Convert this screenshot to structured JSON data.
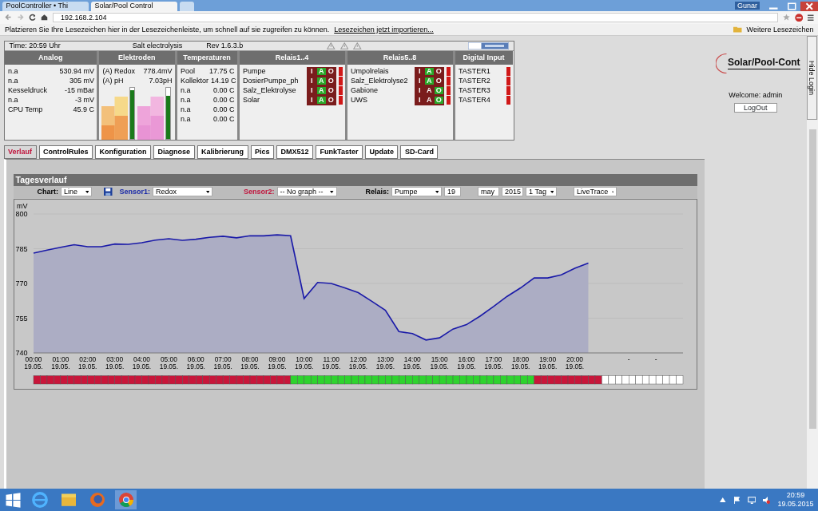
{
  "browser": {
    "tabs": [
      {
        "label": "PoolController • Thi",
        "selected": false
      },
      {
        "label": "Solar/Pool Control",
        "selected": true
      }
    ],
    "user": "Gunar",
    "address": "192.168.2.104",
    "bookmarks_hint": "Platzieren Sie Ihre Lesezeichen hier in der Lesezeichenleiste, um schnell auf sie zugreifen zu können.",
    "bookmarks_link": "Lesezeichen jetzt importieren...",
    "bookmarks_more": "Weitere Lesezeichen"
  },
  "status": {
    "time": "Time: 20:59 Uhr",
    "mode": "Salt electrolysis",
    "revision": "Rev 1.6.3.b"
  },
  "analog": {
    "title": "Analog",
    "rows": [
      {
        "label": "n.a",
        "value": "530.94 mV"
      },
      {
        "label": "n.a",
        "value": "305 mV"
      },
      {
        "label": "Kesseldruck",
        "value": "-15 mBar"
      },
      {
        "label": "n.a",
        "value": "-3 mV"
      },
      {
        "label": "CPU Temp",
        "value": "45.9 C"
      }
    ]
  },
  "electrodes": {
    "title": "Elektroden",
    "rows": [
      {
        "label": "(A) Redox",
        "value": "778.4mV",
        "level": 0.95
      },
      {
        "label": "(A) pH",
        "value": "7.03pH",
        "level": 0.85
      }
    ]
  },
  "temperatures": {
    "title": "Temperaturen",
    "rows": [
      {
        "label": "Pool",
        "value": "17.75 C"
      },
      {
        "label": "Kollektor",
        "value": "14.19 C"
      },
      {
        "label": "n.a",
        "value": "0.00 C"
      },
      {
        "label": "n.a",
        "value": "0.00 C"
      },
      {
        "label": "n.a",
        "value": "0.00 C"
      },
      {
        "label": "n.a",
        "value": "0.00 C"
      }
    ]
  },
  "relays": [
    {
      "title": "Relais1..4",
      "items": [
        {
          "name": "Pumpe",
          "modes": [
            {
              "label": "I",
              "selected": false
            },
            {
              "label": "A",
              "selected": true
            },
            {
              "label": "O",
              "selected": false
            }
          ],
          "on": false
        },
        {
          "name": "DosierPumpe_ph",
          "modes": [
            {
              "label": "I",
              "selected": false
            },
            {
              "label": "A",
              "selected": true
            },
            {
              "label": "O",
              "selected": false
            }
          ],
          "on": false
        },
        {
          "name": "Salz_Elektrolyse",
          "modes": [
            {
              "label": "I",
              "selected": false
            },
            {
              "label": "A",
              "selected": true
            },
            {
              "label": "O",
              "selected": false
            }
          ],
          "on": false
        },
        {
          "name": "Solar",
          "modes": [
            {
              "label": "I",
              "selected": false
            },
            {
              "label": "A",
              "selected": true
            },
            {
              "label": "O",
              "selected": false
            }
          ],
          "on": false
        }
      ]
    },
    {
      "title": "Relais5..8",
      "items": [
        {
          "name": "Umpolrelais",
          "modes": [
            {
              "label": "I",
              "selected": false
            },
            {
              "label": "A",
              "selected": true
            },
            {
              "label": "O",
              "selected": false
            }
          ],
          "on": false
        },
        {
          "name": "Salz_Elektrolyse2",
          "modes": [
            {
              "label": "I",
              "selected": false
            },
            {
              "label": "A",
              "selected": true
            },
            {
              "label": "O",
              "selected": false
            }
          ],
          "on": false
        },
        {
          "name": "Gabione",
          "modes": [
            {
              "label": "I",
              "selected": false
            },
            {
              "label": "A",
              "selected": false
            },
            {
              "label": "O",
              "selected": true
            }
          ],
          "on": false
        },
        {
          "name": "UWS",
          "modes": [
            {
              "label": "I",
              "selected": false
            },
            {
              "label": "A",
              "selected": false
            },
            {
              "label": "O",
              "selected": true
            }
          ],
          "on": false
        }
      ]
    }
  ],
  "digital_input": {
    "title": "Digital Input",
    "items": [
      {
        "name": "TASTER1",
        "on": false
      },
      {
        "name": "TASTER2",
        "on": false
      },
      {
        "name": "TASTER3",
        "on": false
      },
      {
        "name": "TASTER4",
        "on": false
      }
    ]
  },
  "tabs": [
    {
      "label": "Verlauf",
      "selected": true
    },
    {
      "label": "ControlRules",
      "selected": false
    },
    {
      "label": "Konfiguration",
      "selected": false
    },
    {
      "label": "Diagnose",
      "selected": false
    },
    {
      "label": "Kalibrierung",
      "selected": false
    },
    {
      "label": "Pics",
      "selected": false
    },
    {
      "label": "DMX512",
      "selected": false
    },
    {
      "label": "FunkTaster",
      "selected": false
    },
    {
      "label": "Update",
      "selected": false
    },
    {
      "label": "SD-Card",
      "selected": false
    }
  ],
  "panel": {
    "title": "Tagesverlauf",
    "controls": [
      {
        "kind": "label",
        "text": "Chart:"
      },
      {
        "kind": "select",
        "value": "Line"
      },
      {
        "kind": "save"
      },
      {
        "kind": "sensor1",
        "text": "Sensor1:"
      },
      {
        "kind": "select",
        "value": "Redox"
      },
      {
        "kind": "sensor2",
        "text": "Sensor2:"
      },
      {
        "kind": "select",
        "value": "-- No graph --"
      },
      {
        "kind": "label",
        "text": "Relais:"
      },
      {
        "kind": "select",
        "value": "Pumpe"
      },
      {
        "kind": "select",
        "value": "19"
      },
      {
        "kind": "select",
        "value": "may"
      },
      {
        "kind": "select",
        "value": "2015"
      },
      {
        "kind": "select",
        "value": "1 Tag"
      },
      {
        "kind": "select",
        "value": "LiveTrace"
      }
    ],
    "chart_data": {
      "type": "area",
      "ylabel": "mV",
      "categories": [
        "00:00 19.05.",
        null,
        "01:00 19.05.",
        null,
        "02:00 19.05.",
        null,
        "03:00 19.05.",
        null,
        "04:00 19.05.",
        null,
        "05:00 19.05.",
        null,
        "06:00 19.05.",
        null,
        "07:00 19.05.",
        null,
        "08:00 19.05.",
        null,
        "09:00 19.05.",
        null,
        "10:00 19.05.",
        null,
        "11:00 19.05.",
        null,
        "12:00 19.05.",
        null,
        "13:00 19.05.",
        null,
        "14:00 19.05.",
        null,
        "15:00 19.05.",
        null,
        "16:00 19.05.",
        null,
        "17:00 19.05.",
        null,
        "18:00 19.05.",
        null,
        "19:00 19.05.",
        null,
        "20:00 19.05.",
        null,
        null,
        null,
        "-",
        null,
        "-",
        null
      ],
      "series": [
        {
          "color": "#1a1aa8",
          "values": [
            783.1,
            784.4,
            785.6,
            786.7,
            785.9,
            785.9,
            787,
            786.9,
            787.6,
            788.7,
            789.3,
            788.6,
            789.1,
            789.9,
            790.4,
            789.7,
            790.6,
            790.6,
            791,
            790.6,
            763.5,
            770.4,
            770,
            768.1,
            766,
            762.3,
            758.4,
            749.2,
            748.4,
            745.6,
            746.5,
            750.3,
            752.2,
            755.9,
            760,
            764.4,
            768.1,
            772.4,
            772.4,
            773.7,
            776.5,
            778.8,
            null,
            null,
            null,
            null,
            null,
            null
          ]
        }
      ],
      "ylim": [
        740,
        800
      ],
      "yticks": [
        740,
        755,
        770,
        785,
        800
      ],
      "grid": true
    },
    "relay_timeline": [
      {
        "kind": "off"
      },
      {
        "kind": "off"
      },
      {
        "kind": "off"
      },
      {
        "kind": "off"
      },
      {
        "kind": "off"
      },
      {
        "kind": "off"
      },
      {
        "kind": "off"
      },
      {
        "kind": "off"
      },
      {
        "kind": "off"
      },
      {
        "kind": "off"
      },
      {
        "kind": "off"
      },
      {
        "kind": "off"
      },
      {
        "kind": "off"
      },
      {
        "kind": "off"
      },
      {
        "kind": "off"
      },
      {
        "kind": "off"
      },
      {
        "kind": "off"
      },
      {
        "kind": "off"
      },
      {
        "kind": "off"
      },
      {
        "kind": "off"
      },
      {
        "kind": "off"
      },
      {
        "kind": "off"
      },
      {
        "kind": "off"
      },
      {
        "kind": "off"
      },
      {
        "kind": "off"
      },
      {
        "kind": "off"
      },
      {
        "kind": "off"
      },
      {
        "kind": "off"
      },
      {
        "kind": "off"
      },
      {
        "kind": "off"
      },
      {
        "kind": "off"
      },
      {
        "kind": "off"
      },
      {
        "kind": "off"
      },
      {
        "kind": "off"
      },
      {
        "kind": "off"
      },
      {
        "kind": "off"
      },
      {
        "kind": "off"
      },
      {
        "kind": "off"
      },
      {
        "kind": "on"
      },
      {
        "kind": "on"
      },
      {
        "kind": "on"
      },
      {
        "kind": "on"
      },
      {
        "kind": "on"
      },
      {
        "kind": "on"
      },
      {
        "kind": "on"
      },
      {
        "kind": "on"
      },
      {
        "kind": "on"
      },
      {
        "kind": "on"
      },
      {
        "kind": "on"
      },
      {
        "kind": "on"
      },
      {
        "kind": "on"
      },
      {
        "kind": "on"
      },
      {
        "kind": "on"
      },
      {
        "kind": "on"
      },
      {
        "kind": "on"
      },
      {
        "kind": "on"
      },
      {
        "kind": "on"
      },
      {
        "kind": "on"
      },
      {
        "kind": "on"
      },
      {
        "kind": "on"
      },
      {
        "kind": "on"
      },
      {
        "kind": "on"
      },
      {
        "kind": "on"
      },
      {
        "kind": "on"
      },
      {
        "kind": "on"
      },
      {
        "kind": "on"
      },
      {
        "kind": "on"
      },
      {
        "kind": "on"
      },
      {
        "kind": "on"
      },
      {
        "kind": "on"
      },
      {
        "kind": "on"
      },
      {
        "kind": "on"
      },
      {
        "kind": "on"
      },
      {
        "kind": "on"
      },
      {
        "kind": "off"
      },
      {
        "kind": "off"
      },
      {
        "kind": "off"
      },
      {
        "kind": "off"
      },
      {
        "kind": "off"
      },
      {
        "kind": "off"
      },
      {
        "kind": "off"
      },
      {
        "kind": "off"
      },
      {
        "kind": "off"
      },
      {
        "kind": "off"
      },
      {
        "kind": "none"
      },
      {
        "kind": "none"
      },
      {
        "kind": "none"
      },
      {
        "kind": "none"
      },
      {
        "kind": "none"
      },
      {
        "kind": "none"
      },
      {
        "kind": "none"
      },
      {
        "kind": "none"
      },
      {
        "kind": "none"
      },
      {
        "kind": "none"
      },
      {
        "kind": "none"
      },
      {
        "kind": "none"
      }
    ]
  },
  "side": {
    "logo": "Solar/Pool-Cont",
    "welcome": "Welcome: admin",
    "logout": "LogOut",
    "hide_login": "Hide Login"
  },
  "taskbar": {
    "time": "20:59",
    "date": "19.05.2015"
  }
}
